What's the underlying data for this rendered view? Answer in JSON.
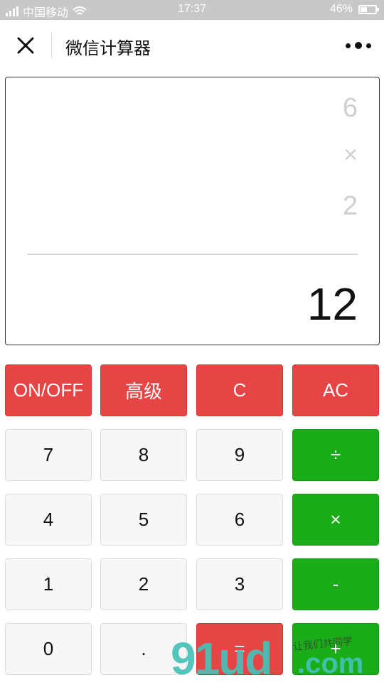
{
  "status_bar": {
    "carrier": "中国移动",
    "time": "17:37",
    "battery": "46%",
    "battery_level": 0.46
  },
  "nav": {
    "title": "微信计算器"
  },
  "display": {
    "lines": [
      "6",
      "×",
      "2"
    ],
    "result": "12"
  },
  "keys": [
    [
      {
        "label": "ON/OFF",
        "color": "red"
      },
      {
        "label": "高级",
        "color": "red"
      },
      {
        "label": "C",
        "color": "red"
      },
      {
        "label": "AC",
        "color": "red"
      }
    ],
    [
      {
        "label": "7",
        "color": "grey"
      },
      {
        "label": "8",
        "color": "grey"
      },
      {
        "label": "9",
        "color": "grey"
      },
      {
        "label": "÷",
        "color": "green"
      }
    ],
    [
      {
        "label": "4",
        "color": "grey"
      },
      {
        "label": "5",
        "color": "grey"
      },
      {
        "label": "6",
        "color": "grey"
      },
      {
        "label": "×",
        "color": "green"
      }
    ],
    [
      {
        "label": "1",
        "color": "grey"
      },
      {
        "label": "2",
        "color": "grey"
      },
      {
        "label": "3",
        "color": "grey"
      },
      {
        "label": "-",
        "color": "green"
      }
    ],
    [
      {
        "label": "0",
        "color": "grey"
      },
      {
        "label": ".",
        "color": "grey"
      },
      {
        "label": "=",
        "color": "red"
      },
      {
        "label": "+",
        "color": "green"
      }
    ]
  ],
  "watermark": {
    "brand": "91ud",
    "domain": ".com",
    "tagline": "让我们共同学"
  },
  "colors": {
    "red": "#e64545",
    "green": "#1aad19",
    "grey": "#f7f7f7"
  }
}
